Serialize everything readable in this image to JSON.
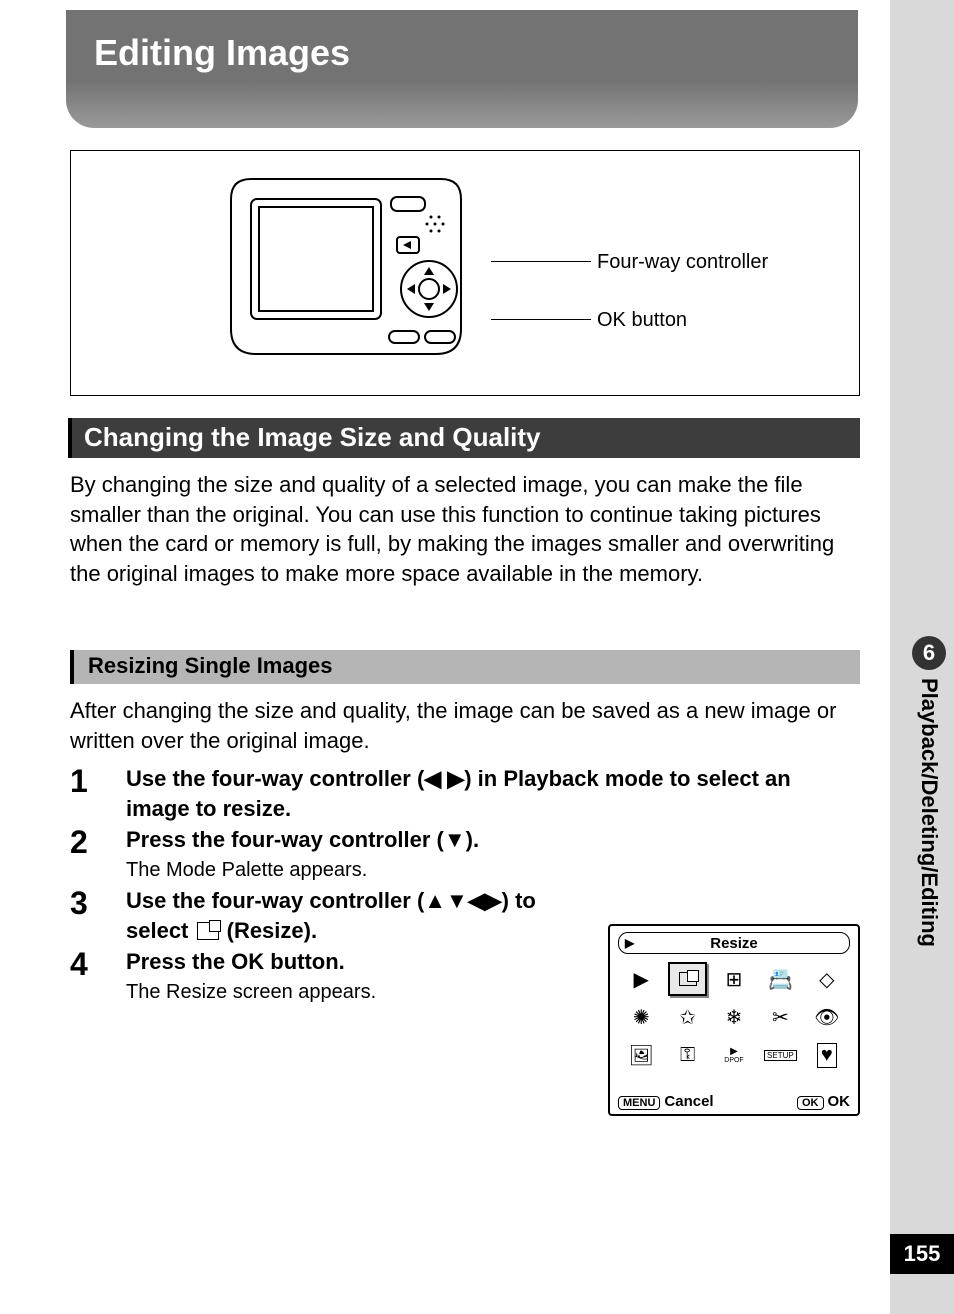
{
  "page_number": "155",
  "side_tab": {
    "number": "6",
    "label": "Playback/Deleting/Editing"
  },
  "title": "Editing Images",
  "diagram": {
    "callout1": "Four-way controller",
    "callout2": "OK button"
  },
  "section_heading": "Changing the Image Size and Quality",
  "intro_para": "By changing the size and quality of a selected image, you can make the file smaller than the original. You can use this function to continue taking pictures when the card or memory is full, by making the images smaller and overwriting the original images to make more space available in the memory.",
  "sub_heading": "Resizing Single Images",
  "after_para": "After changing the size and quality, the image can be saved as a new image or written over the original image.",
  "steps": [
    {
      "num": "1",
      "title_pre": "Use the four-way controller (",
      "title_mid": "◀ ▶",
      "title_post": ") in Playback mode to select an image to resize.",
      "note": ""
    },
    {
      "num": "2",
      "title_pre": "Press the four-way controller (",
      "title_mid": "▼",
      "title_post": ").",
      "note": "The Mode Palette appears."
    },
    {
      "num": "3",
      "title_pre": "Use the four-way controller (",
      "title_mid": "▲▼◀▶",
      "title_post": ") to select ",
      "title_end": " (Resize).",
      "note": ""
    },
    {
      "num": "4",
      "title_pre": "Press the OK button.",
      "title_mid": "",
      "title_post": "",
      "note": "The Resize screen appears."
    }
  ],
  "palette": {
    "title": "Resize",
    "menu_key": "MENU",
    "cancel": "Cancel",
    "ok_key": "OK",
    "ok": "OK"
  }
}
